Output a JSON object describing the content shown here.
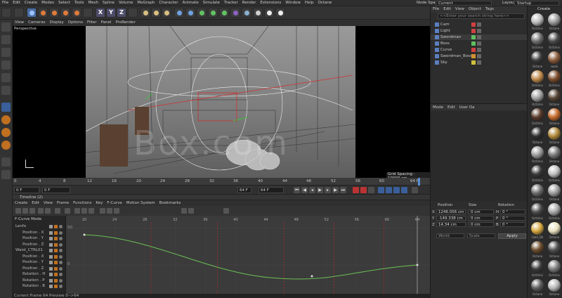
{
  "menubar": {
    "items": [
      "File",
      "Edit",
      "Create",
      "Modes",
      "Select",
      "Tools",
      "Mesh",
      "Spline",
      "Volume",
      "MoGraph",
      "Character",
      "Animate",
      "Simulate",
      "Tracker",
      "Render",
      "Extensions",
      "Window",
      "Help",
      "Octane"
    ],
    "node_space_label": "Node Space:",
    "node_space_value": "Current (Standard/Physical)",
    "layout_label": "Layout:",
    "layout_value": "Startup"
  },
  "viewport": {
    "menu": [
      "View",
      "Cameras",
      "Display",
      "Options",
      "Filter",
      "Panel",
      "ProRender"
    ],
    "camera_label": "Perspective",
    "grid_spacing": "Grid Spacing : 10000 cm"
  },
  "timeline_ruler": {
    "ticks": [
      "0",
      "4",
      "8",
      "12",
      "16",
      "20",
      "24",
      "28",
      "32",
      "36",
      "40",
      "44",
      "48",
      "52",
      "56",
      "60",
      "64 F"
    ]
  },
  "transport": {
    "field_start": "0 F",
    "field_current": "0 F",
    "field_end": "64 F",
    "field_end2": "64 F"
  },
  "timeline": {
    "title": "Timeline (2)",
    "menu": [
      "Create",
      "Edit",
      "View",
      "Frame",
      "Functions",
      "Key",
      "F-Curve",
      "Motion System",
      "Bookmarks"
    ],
    "mode_label": "F-Curve Mode",
    "frame_ticks": [
      "20",
      "24",
      "28",
      "32",
      "36",
      "40",
      "44",
      "48",
      "52",
      "56",
      "60",
      "64"
    ],
    "tracks": [
      {
        "name": "Lenfo",
        "indent": 0
      },
      {
        "name": "Position . X",
        "indent": 1
      },
      {
        "name": "Position . Y",
        "indent": 1
      },
      {
        "name": "Position . Z",
        "indent": 1
      },
      {
        "name": "Waist_CTRL01",
        "indent": 0
      },
      {
        "name": "Position . X",
        "indent": 1
      },
      {
        "name": "Position . Y",
        "indent": 1
      },
      {
        "name": "Position . Z",
        "indent": 1
      },
      {
        "name": "Rotation . H",
        "indent": 1
      },
      {
        "name": "Rotation . P",
        "indent": 1
      },
      {
        "name": "Rotation . B",
        "indent": 1
      }
    ],
    "value_labels": [
      "50",
      "0"
    ],
    "status": "Current Frame  64  Preview  0-->64"
  },
  "object_manager": {
    "menu": [
      "File",
      "Edit",
      "View",
      "Object",
      "Tags"
    ],
    "search_placeholder": "<<Enter your search string here>>",
    "objects": [
      {
        "name": "Cam",
        "color": "#d04040"
      },
      {
        "name": "Light",
        "color": "#d04040"
      },
      {
        "name": "Swordman",
        "color": "#5fbf5f"
      },
      {
        "name": "Boss",
        "color": "#5fbf5f"
      },
      {
        "name": "Curve",
        "color": "#d04040"
      },
      {
        "name": "Swordman_Boss",
        "color": "#d09030"
      },
      {
        "name": "Sky",
        "color": "#d0c040"
      }
    ]
  },
  "attributes": {
    "menu": [
      "Mode",
      "Edit",
      "User Da"
    ]
  },
  "coordinates": {
    "headers": [
      "Position",
      "Size",
      "Rotation"
    ],
    "rows": [
      {
        "axis": "X",
        "pos": "1246.056 cm",
        "size": "0 cm",
        "rot_axis": "H",
        "rot": "0 °"
      },
      {
        "axis": "Y",
        "pos": "-149.338 cm",
        "size": "0 cm",
        "rot_axis": "P",
        "rot": "0 °"
      },
      {
        "axis": "Z",
        "pos": "14.34 cm",
        "size": "0 cm",
        "rot_axis": "B",
        "rot": "0 °"
      }
    ],
    "mode_left": "World",
    "mode_right": "Scale",
    "apply_label": "Apply"
  },
  "materials": {
    "title": "Create",
    "items": [
      {
        "name": "OctUniv",
        "color": "#bcbcbc"
      },
      {
        "name": "Octane",
        "color": "#9a9a9a"
      },
      {
        "name": "OctUniv",
        "color": "#6e6e6e"
      },
      {
        "name": "OctUniv",
        "color": "#4a4a4a"
      },
      {
        "name": "Octane",
        "color": "#3b3b3b"
      },
      {
        "name": "sephi",
        "color": "#8a5a3a"
      },
      {
        "name": "OctUniv",
        "color": "#c08a4a"
      },
      {
        "name": "OctUniv",
        "color": "#7b4b2b"
      },
      {
        "name": "OctUniv",
        "color": "#a0a0a0"
      },
      {
        "name": "Octane",
        "color": "#554433"
      },
      {
        "name": "OctUniv",
        "color": "#5a3a2a"
      },
      {
        "name": "Octane",
        "color": "#c46a2a"
      },
      {
        "name": "Octane",
        "color": "#2f2f2f"
      },
      {
        "name": "Octane",
        "color": "#b0893a"
      },
      {
        "name": "OctUniv",
        "color": "#999999"
      },
      {
        "name": "Octane",
        "color": "#777777"
      },
      {
        "name": "OctUniv",
        "color": "#3a3a3a"
      },
      {
        "name": "OctUniv",
        "color": "#c0c0c0"
      },
      {
        "name": "OctUniv",
        "color": "#6a6a6a"
      },
      {
        "name": "Octane",
        "color": "#9d9d9d"
      },
      {
        "name": "OctUniv",
        "color": "#4c4c4c"
      },
      {
        "name": "OctUniv",
        "color": "#a8a8a8"
      },
      {
        "name": "Gold_Dk",
        "color": "#d4a640"
      },
      {
        "name": "Octane",
        "color": "#e8e0c0"
      },
      {
        "name": "Octane",
        "color": "#6b4b2b"
      },
      {
        "name": "Octane",
        "color": "#505050"
      },
      {
        "name": "OctUniv",
        "color": "#3c3c3c"
      },
      {
        "name": "OctUniv",
        "color": "#7c7c7c"
      },
      {
        "name": "Octane",
        "color": "#5e5e5e"
      },
      {
        "name": "Octane",
        "color": "#b7b7b7"
      }
    ]
  },
  "watermark": "Box.com"
}
